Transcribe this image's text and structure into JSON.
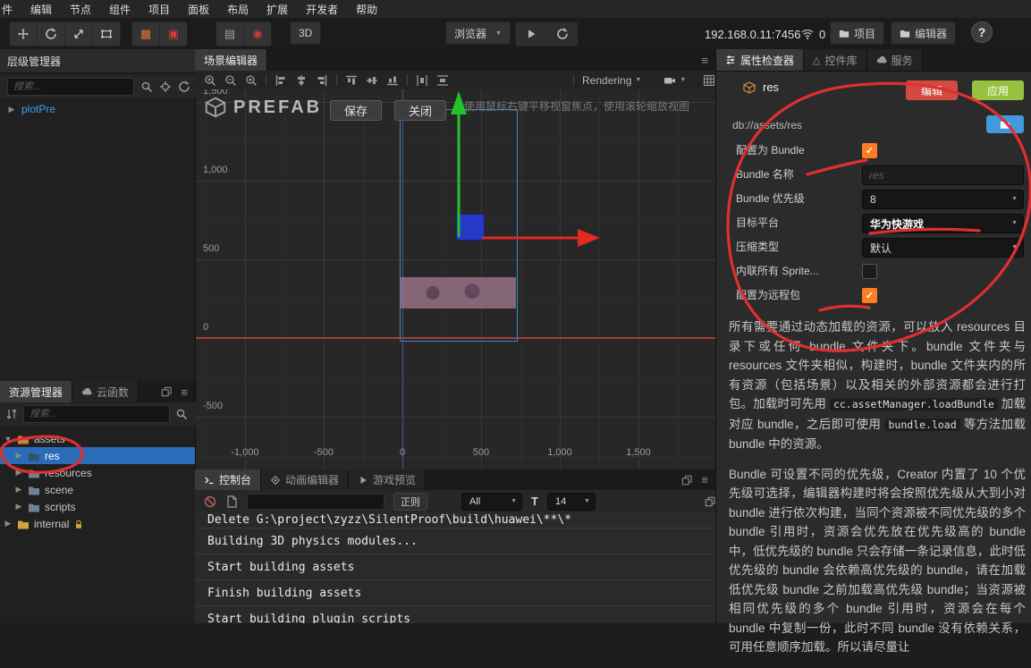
{
  "menubar": {
    "items": [
      "件",
      "编辑",
      "节点",
      "组件",
      "项目",
      "面板",
      "布局",
      "扩展",
      "开发者",
      "帮助"
    ]
  },
  "toolbar": {
    "mode_3d": "3D",
    "browser": "浏览器",
    "address": "192.168.0.11:7456",
    "connections": "0",
    "project": "项目",
    "editor": "编辑器",
    "help": "?"
  },
  "hierarchy": {
    "title": "层级管理器",
    "search_placeholder": "搜索...",
    "node": "plotPre"
  },
  "assets": {
    "tab_assets": "资源管理器",
    "tab_cloud": "云函数",
    "search_placeholder": "搜索...",
    "tree": [
      {
        "label": "assets",
        "selected": false
      },
      {
        "label": "res",
        "selected": true
      },
      {
        "label": "resources",
        "selected": false
      },
      {
        "label": "scene",
        "selected": false
      },
      {
        "label": "scripts",
        "selected": false
      },
      {
        "label": "internal",
        "selected": false
      }
    ]
  },
  "scene": {
    "tab": "场景编辑器",
    "rendering": "Rendering",
    "prefab": "PREFAB",
    "save": "保存",
    "close": "关闭",
    "hint": "使用鼠标右键平移视窗焦点，使用滚轮缩放视图",
    "y_ticks": [
      "1,500",
      "1,000",
      "500",
      "0",
      "-500"
    ],
    "x_ticks": [
      "-1,000",
      "-500",
      "0",
      "500",
      "1,000",
      "1,500"
    ]
  },
  "console": {
    "tab_console": "控制台",
    "tab_animation": "动画编辑器",
    "tab_preview": "游戏预览",
    "regex_label": "正则",
    "filter_value": "All",
    "font_icon": "T",
    "font_size": "14",
    "logs": [
      "Delete G:\\project\\zyzz\\SilentProof\\build\\huawei\\**\\*",
      "Building 3D physics modules...",
      "Start building assets",
      "Finish building assets",
      "Start building plugin scripts"
    ]
  },
  "inspector": {
    "tab_inspector": "属性检查器",
    "tab_widgets": "控件库",
    "tab_service": "服务",
    "node_name": "res",
    "edit": "编辑",
    "apply": "应用",
    "path": "db://assets/res",
    "rows": [
      {
        "label": "配置为 Bundle",
        "checked": true
      },
      {
        "label": "Bundle 名称",
        "placeholder": "res"
      },
      {
        "label": "Bundle 优先级",
        "value": "8"
      },
      {
        "label": "目标平台",
        "value": "华为快游戏"
      },
      {
        "label": "压缩类型",
        "value": "默认"
      },
      {
        "label": "内联所有 Sprite...",
        "checked": false
      },
      {
        "label": "配置为远程包",
        "checked": true
      }
    ],
    "help1a": "所有需要通过动态加载的资源，可以放入 resources 目录下或任何 bundle 文件夹下。bundle 文件夹与 resources 文件夹相似，构建时，bundle 文件夹内的所有资源（包括场景）以及相关的外部资源都会进行打包。加载时可先用 ",
    "code1": "cc.assetManager.loadBundle",
    "help1b": " 加载对应 bundle，之后即可使用 ",
    "code2": "bundle.load",
    "help1c": " 等方法加载 bundle 中的资源。",
    "help2": "Bundle 可设置不同的优先级，Creator 内置了 10 个优先级可选择，编辑器构建时将会按照优先级从大到小对 bundle 进行依次构建，当同个资源被不同优先级的多个 bundle 引用时，资源会优先放在优先级高的 bundle 中，低优先级的 bundle 只会存储一条记录信息，此时低优先级的 bundle 会依赖高优先级的 bundle，请在加载低优先级 bundle 之前加载高优先级 bundle；当资源被相同优先级的多个 bundle 引用时，资源会在每个 bundle 中复制一份，此时不同 bundle 没有依赖关系，可用任意顺序加载。所以请尽量让"
  },
  "colors": {
    "selection": "#2b6cb8",
    "accent-blue": "#3f9bff",
    "checkbox-orange": "#ff7d21",
    "edit-red": "#d04b41",
    "apply-green": "#95c13f",
    "folder-btn-blue": "#3f9ae0",
    "annotation-red": "#e12f2f",
    "gizmo-green": "#1fc32a",
    "gizmo-red": "#df2b20",
    "node-blue": "#2839c9",
    "axis-red": "#a33c38",
    "axis-blue": "#3e5a85"
  }
}
